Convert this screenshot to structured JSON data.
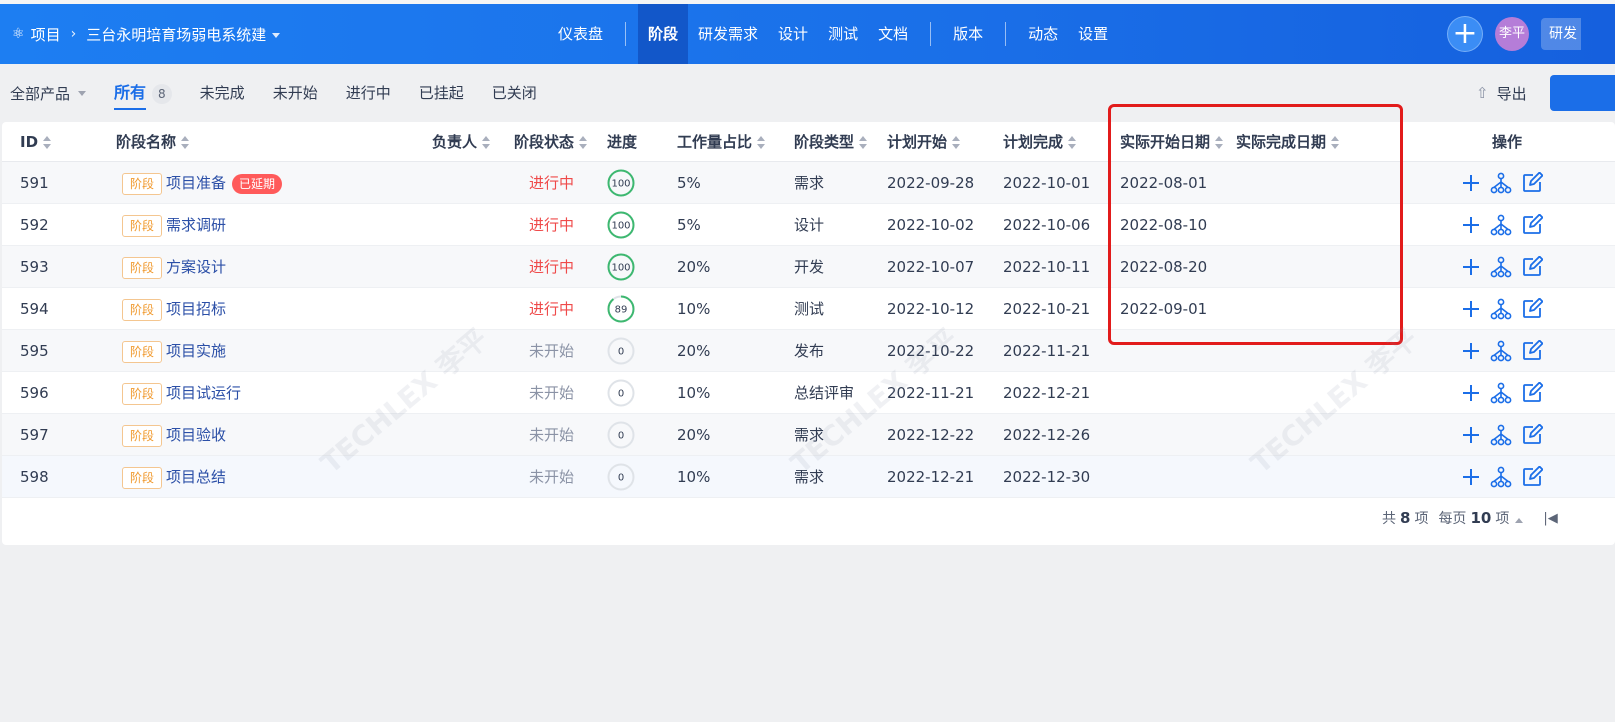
{
  "header": {
    "breadcrumb_root": "项目",
    "project_name": "三台永明培育场弱电系统建",
    "nav": [
      "仪表盘",
      "阶段",
      "研发需求",
      "设计",
      "测试",
      "文档",
      "版本",
      "动态",
      "设置"
    ],
    "active_nav": "阶段",
    "avatar_text": "李平",
    "more_text": "研发"
  },
  "toolbar": {
    "product_select": "全部产品",
    "tabs": [
      {
        "label": "所有",
        "count": "8"
      },
      {
        "label": "未完成"
      },
      {
        "label": "未开始"
      },
      {
        "label": "进行中"
      },
      {
        "label": "已挂起"
      },
      {
        "label": "已关闭"
      }
    ],
    "export_label": "导出"
  },
  "table": {
    "columns": [
      "ID",
      "阶段名称",
      "负责人",
      "阶段状态",
      "进度",
      "工作量占比",
      "阶段类型",
      "计划开始",
      "计划完成",
      "实际开始日期",
      "实际完成日期",
      "操作"
    ],
    "tag_label": "阶段",
    "delay_label": "已延期",
    "rows": [
      {
        "id": "591",
        "name": "项目准备",
        "status": "进行中",
        "progress": 100,
        "progress_text": "100",
        "workload": "5%",
        "type": "需求",
        "plan_start": "2022-09-28",
        "plan_end": "2022-10-01",
        "actual_start": "2022-08-01",
        "delayed": true
      },
      {
        "id": "592",
        "name": "需求调研",
        "status": "进行中",
        "progress": 100,
        "progress_text": "100",
        "workload": "5%",
        "type": "设计",
        "plan_start": "2022-10-02",
        "plan_end": "2022-10-06",
        "actual_start": "2022-08-10"
      },
      {
        "id": "593",
        "name": "方案设计",
        "status": "进行中",
        "progress": 100,
        "progress_text": "100",
        "workload": "20%",
        "type": "开发",
        "plan_start": "2022-10-07",
        "plan_end": "2022-10-11",
        "actual_start": "2022-08-20"
      },
      {
        "id": "594",
        "name": "项目招标",
        "status": "进行中",
        "progress": 89,
        "progress_text": "89",
        "workload": "10%",
        "type": "测试",
        "plan_start": "2022-10-12",
        "plan_end": "2022-10-21",
        "actual_start": "2022-09-01"
      },
      {
        "id": "595",
        "name": "项目实施",
        "status": "未开始",
        "progress": 0,
        "progress_text": "0",
        "workload": "20%",
        "type": "发布",
        "plan_start": "2022-10-22",
        "plan_end": "2022-11-21",
        "actual_start": ""
      },
      {
        "id": "596",
        "name": "项目试运行",
        "status": "未开始",
        "progress": 0,
        "progress_text": "0",
        "workload": "10%",
        "type": "总结评审",
        "plan_start": "2022-11-21",
        "plan_end": "2022-12-21",
        "actual_start": ""
      },
      {
        "id": "597",
        "name": "项目验收",
        "status": "未开始",
        "progress": 0,
        "progress_text": "0",
        "workload": "20%",
        "type": "需求",
        "plan_start": "2022-12-22",
        "plan_end": "2022-12-26",
        "actual_start": ""
      },
      {
        "id": "598",
        "name": "项目总结",
        "status": "未开始",
        "progress": 0,
        "progress_text": "0",
        "workload": "10%",
        "type": "需求",
        "plan_start": "2022-12-21",
        "plan_end": "2022-12-30",
        "actual_start": ""
      }
    ]
  },
  "pagination": {
    "total_prefix": "共",
    "total": "8",
    "total_suffix": "项",
    "per_page_prefix": "每页",
    "per_page": "10",
    "per_page_suffix": "项",
    "first_page": "|◀"
  },
  "watermark": "TECHLEX 李平",
  "colors": {
    "primary": "#1b6ee8",
    "header": "#1d7ef2",
    "doing": "#ef4a4a",
    "highlight": "#e21b1b",
    "tag": "#f09a2f",
    "ring": "#3db870"
  }
}
